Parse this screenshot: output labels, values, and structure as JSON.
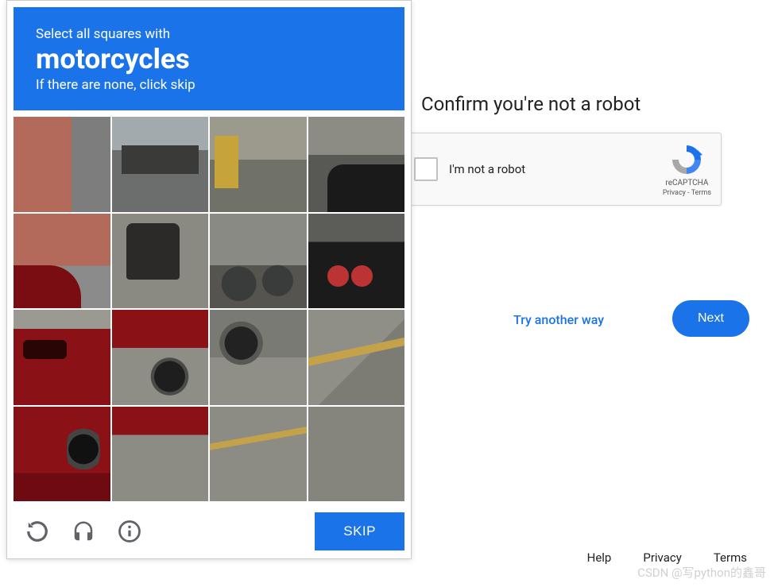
{
  "page": {
    "confirm_heading": "Confirm you're not a robot"
  },
  "recaptcha": {
    "label": "I'm not a robot",
    "brand": "reCAPTCHA",
    "privacy": "Privacy",
    "terms": "Terms",
    "separator": " - "
  },
  "challenge": {
    "line1": "Select all squares with",
    "target": "motorcycles",
    "line3": "If there are none, click skip",
    "grid_rows": 4,
    "grid_cols": 4,
    "skip_label": "SKIP",
    "icons": {
      "reload": "reload-icon",
      "audio": "headphones-icon",
      "info": "info-icon"
    }
  },
  "actions": {
    "try_another": "Try another way",
    "next": "Next"
  },
  "footer": {
    "help": "Help",
    "privacy": "Privacy",
    "terms": "Terms"
  },
  "watermark": "CSDN @写python的鑫哥"
}
